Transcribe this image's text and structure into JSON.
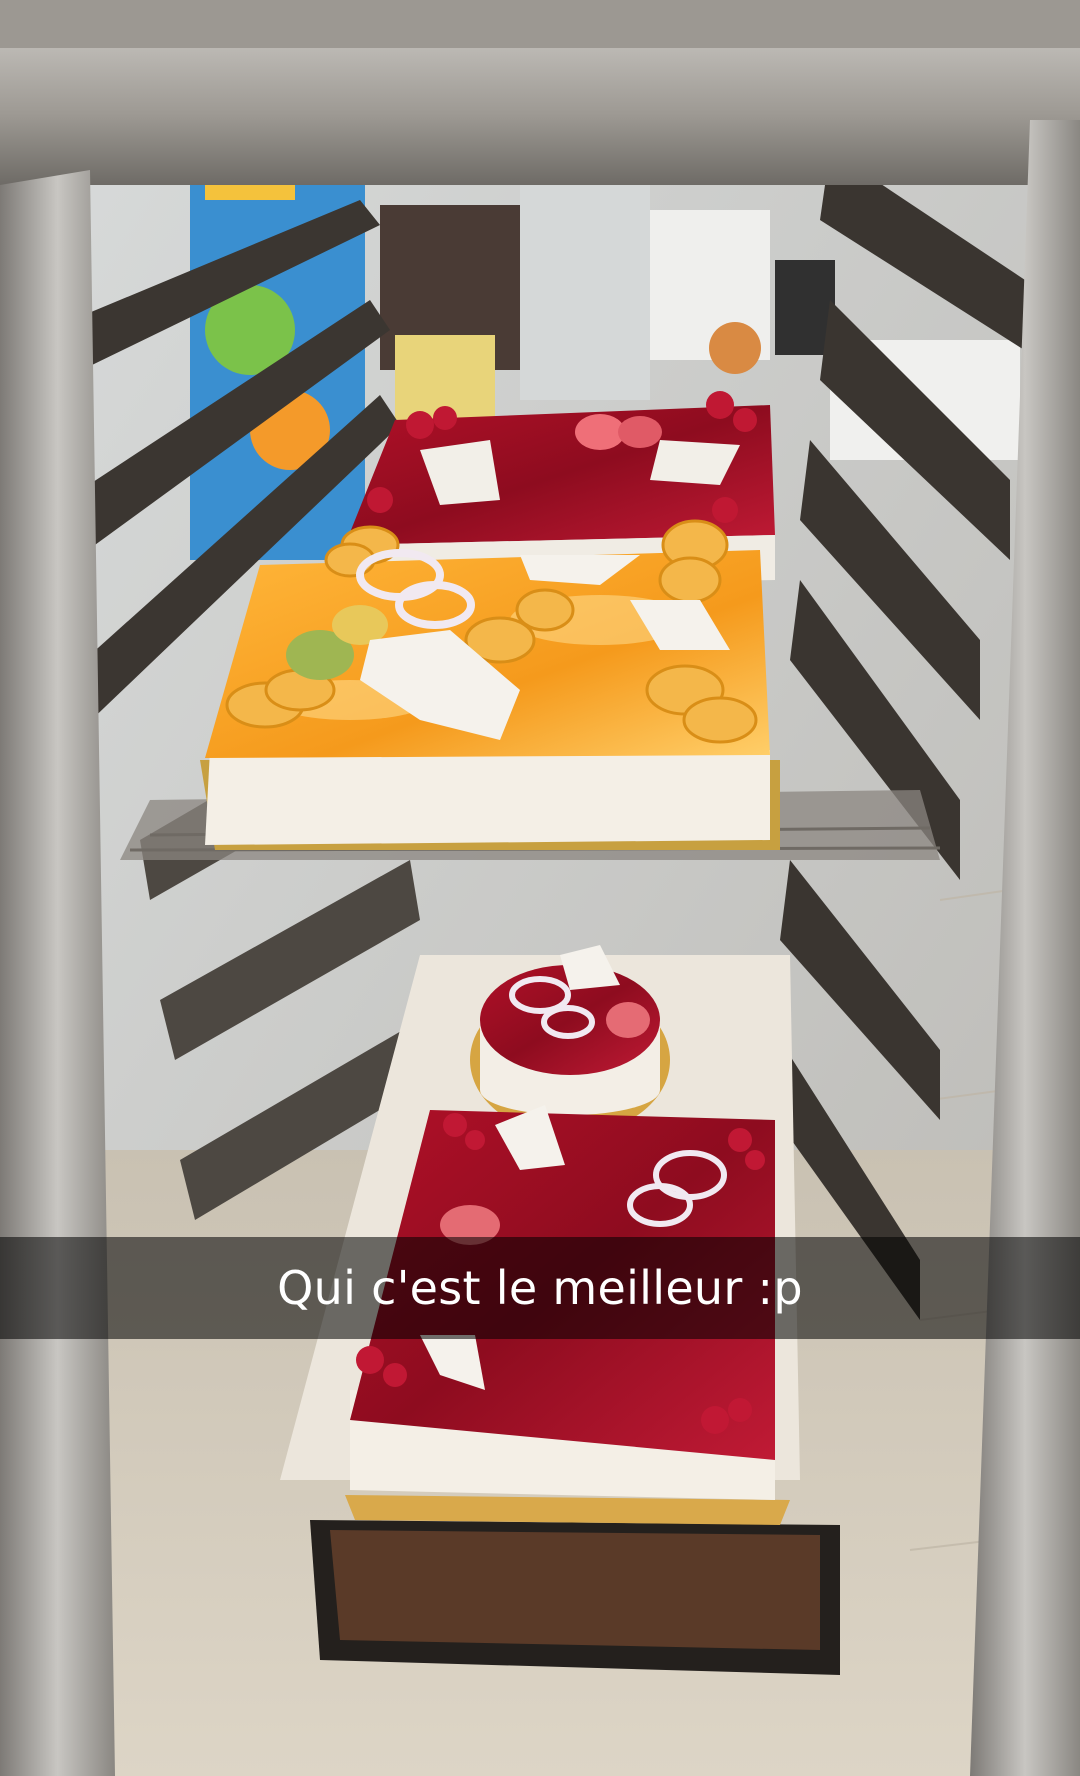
{
  "caption": {
    "text": "Qui c'est le meilleur :p"
  },
  "photo": {
    "subject": "rack-with-cakes-icon"
  },
  "colors": {
    "caption_bar": "#000000",
    "caption_text": "#ffffff",
    "rack_metal": "#9a9690",
    "orange_glaze": "#f2a12c",
    "red_glaze": "#a8142a",
    "cream": "#f4efe6"
  }
}
